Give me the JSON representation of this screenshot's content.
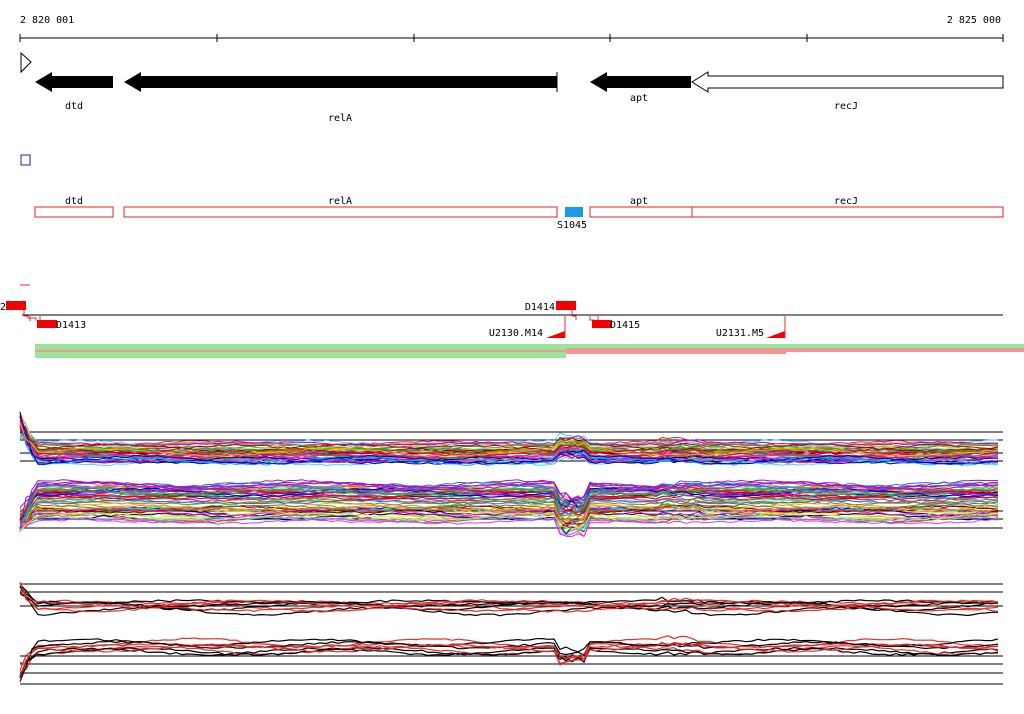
{
  "ruler": {
    "start_label": "2 820 001",
    "end_label": "2 825 000"
  },
  "genes": [
    {
      "name": "dtd",
      "strand": "-",
      "style": "filled"
    },
    {
      "name": "relA",
      "strand": "-",
      "style": "filled"
    },
    {
      "name": "apt",
      "strand": "-",
      "style": "filled"
    },
    {
      "name": "recJ",
      "strand": "-",
      "style": "outline"
    }
  ],
  "annotations": [
    {
      "name": "dtd"
    },
    {
      "name": "relA"
    },
    {
      "name": "apt"
    },
    {
      "name": "recJ"
    }
  ],
  "feature": {
    "name": "S1045",
    "color": "#1a9be6"
  },
  "track_labels": {
    "left_marker": "2",
    "d1413": "D1413",
    "d1414": "D1414",
    "d1415": "D1415",
    "u2130": "U2130.M14",
    "u2131": "U2131.M5"
  },
  "colors": {
    "annotation": "#e0262a",
    "marker": "#f20000",
    "green": "#33cc33",
    "red": "#e03030",
    "blue": "#2222aa"
  }
}
